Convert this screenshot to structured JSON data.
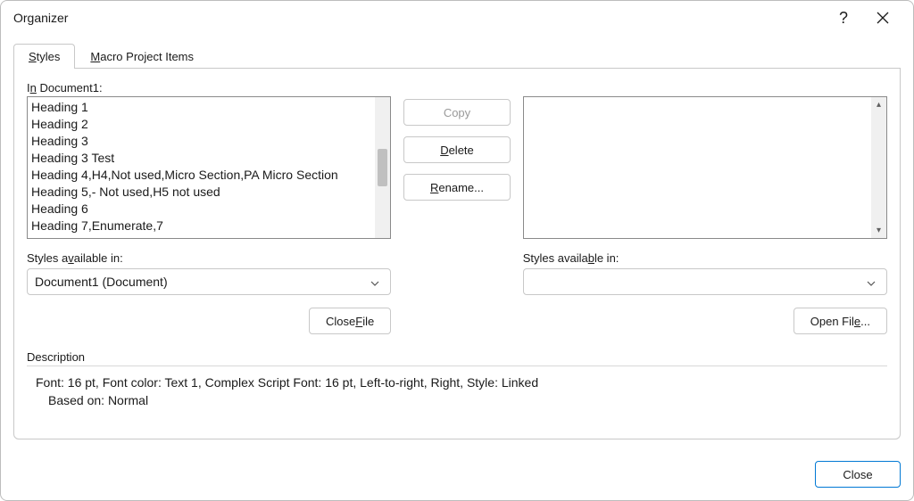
{
  "title": "Organizer",
  "tabs": {
    "styles": "Styles",
    "macro": "Macro Project Items"
  },
  "left": {
    "label_prefix": "In ",
    "label_doc": "Document1:",
    "items": [
      "Heading 1",
      "Heading 2",
      "Heading 3",
      "Heading 3 Test",
      "Heading 4,H4,Not used,Micro Section,PA Micro Section",
      "Heading 5,- Not used,H5 not used",
      "Heading 6",
      "Heading 7,Enumerate,7"
    ],
    "avail_label": "Styles available in:",
    "avail_value": "Document1 (Document)",
    "file_btn": "Close File"
  },
  "mid": {
    "copy": "Copy",
    "delete": "Delete",
    "rename": "Rename..."
  },
  "right": {
    "avail_label": "Styles available in:",
    "avail_value": "",
    "file_btn": "Open File..."
  },
  "description": {
    "header": "Description",
    "line1": "Font: 16 pt, Font color: Text 1, Complex Script Font: 16 pt, Left-to-right, Right, Style: Linked",
    "line2": "Based on: Normal"
  },
  "close_btn": "Close"
}
